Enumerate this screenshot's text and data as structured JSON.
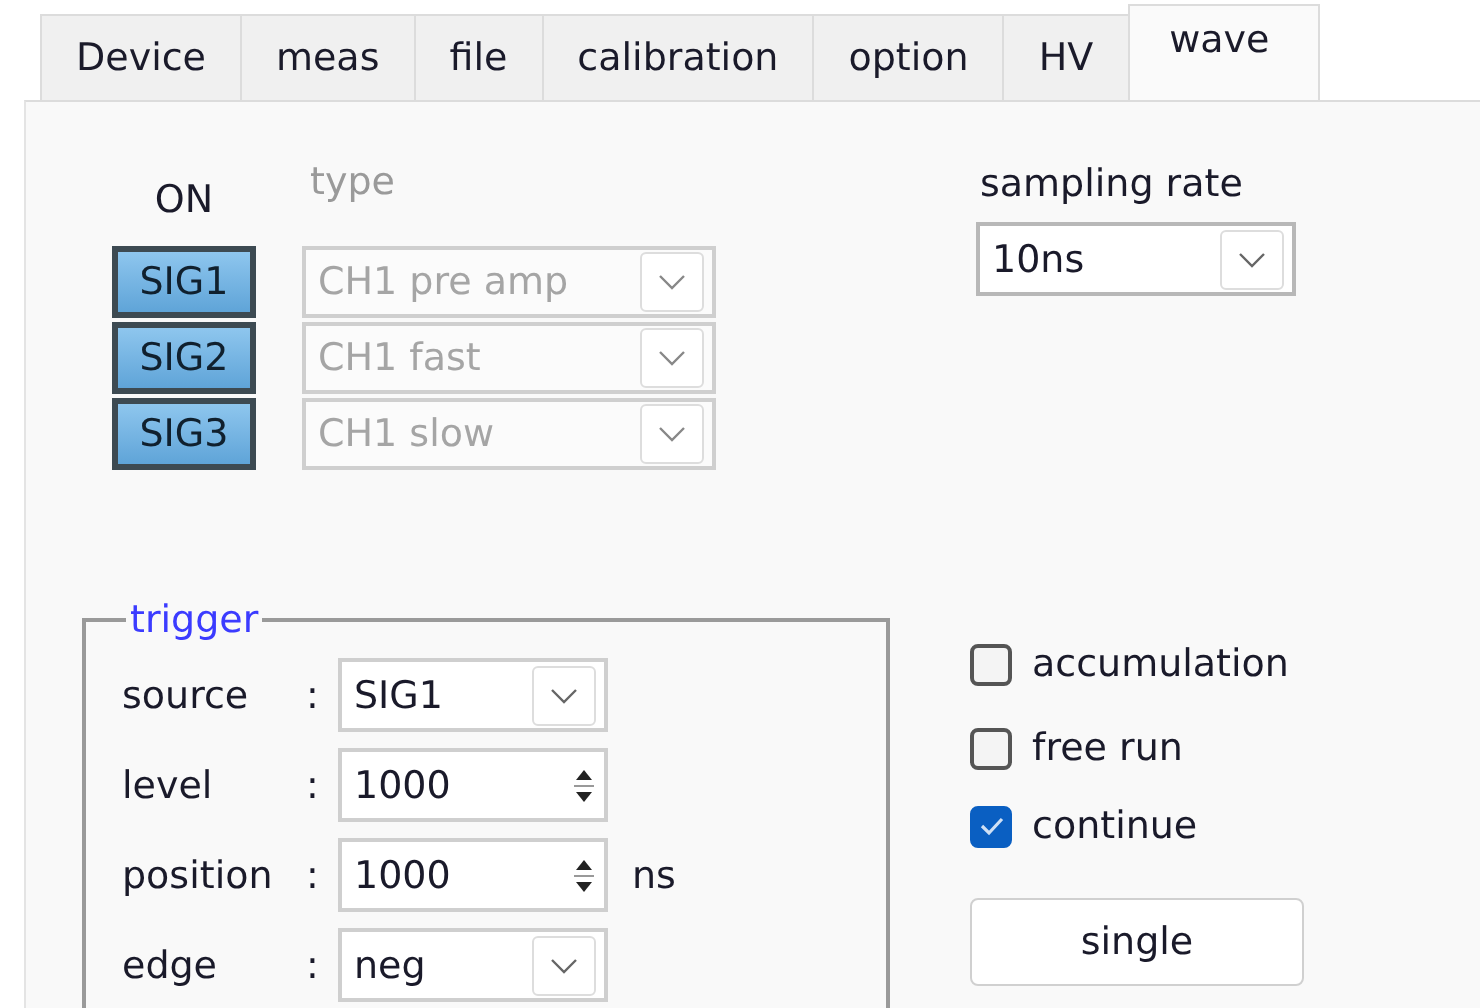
{
  "tabs": [
    {
      "label": "Device",
      "selected": false
    },
    {
      "label": "meas",
      "selected": false
    },
    {
      "label": "file",
      "selected": false
    },
    {
      "label": "calibration",
      "selected": false
    },
    {
      "label": "option",
      "selected": false
    },
    {
      "label": "HV",
      "selected": false
    },
    {
      "label": "wave",
      "selected": true
    }
  ],
  "signals": {
    "on_label": "ON",
    "type_label": "type",
    "rows": [
      {
        "button": "SIG1",
        "on": true,
        "type": "CH1 pre amp",
        "disabled": true
      },
      {
        "button": "SIG2",
        "on": true,
        "type": "CH1 fast",
        "disabled": true
      },
      {
        "button": "SIG3",
        "on": true,
        "type": "CH1 slow",
        "disabled": true
      }
    ]
  },
  "sampling_rate": {
    "label": "sampling rate",
    "value": "10ns"
  },
  "trigger": {
    "title": "trigger",
    "fields": [
      {
        "kind": "dropdown",
        "label": "source",
        "separator": ":",
        "value": "SIG1"
      },
      {
        "kind": "spin",
        "label": "level",
        "separator": ":",
        "value": "1000"
      },
      {
        "kind": "spin",
        "label": "position",
        "separator": ":",
        "value": "1000",
        "unit": "ns"
      },
      {
        "kind": "dropdown",
        "label": "edge",
        "separator": ":",
        "value": "neg"
      }
    ]
  },
  "options": [
    {
      "label": "accumulation",
      "checked": false
    },
    {
      "label": "free run",
      "checked": false
    },
    {
      "label": "continue",
      "checked": true
    }
  ],
  "single_button": "single"
}
